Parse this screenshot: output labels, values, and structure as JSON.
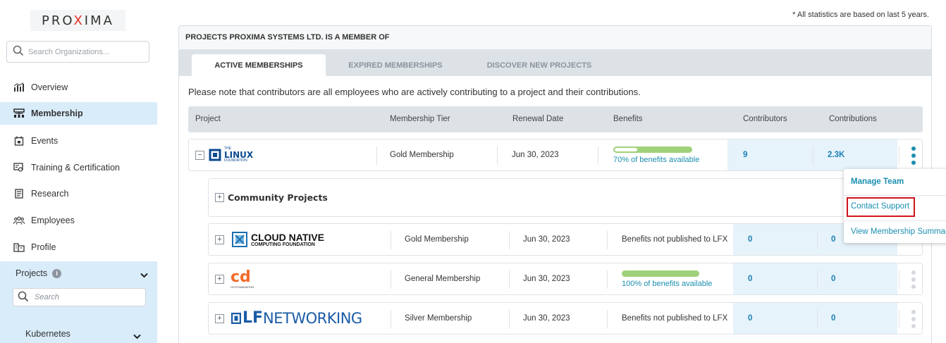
{
  "logo": {
    "pre": "PRO",
    "x": "X",
    "post": "IMA"
  },
  "sidebar": {
    "search_placeholder": "Search Organizations...",
    "items": [
      {
        "label": "Overview",
        "icon": "chart-icon"
      },
      {
        "label": "Membership",
        "icon": "membership-icon"
      },
      {
        "label": "Events",
        "icon": "calendar-icon"
      },
      {
        "label": "Training & Certification",
        "icon": "certification-icon"
      },
      {
        "label": "Research",
        "icon": "research-icon"
      },
      {
        "label": "Employees",
        "icon": "employees-icon"
      },
      {
        "label": "Profile",
        "icon": "profile-icon"
      }
    ],
    "projects": {
      "label": "Projects",
      "info": "i",
      "search_placeholder": "Search",
      "items": [
        {
          "label": "Kubernetes"
        }
      ]
    }
  },
  "stat_note": "* All statistics are based on last 5 years.",
  "card": {
    "title": "PROJECTS PROXIMA SYSTEMS LTD. IS A MEMBER OF",
    "tabs": [
      {
        "label": "ACTIVE MEMBERSHIPS"
      },
      {
        "label": "EXPIRED MEMBERSHIPS"
      },
      {
        "label": "DISCOVER NEW PROJECTS"
      }
    ],
    "note": "Please note that contributors are all employees who are actively contributing to a project and their contributions.",
    "columns": {
      "project": "Project",
      "tier": "Membership Tier",
      "renewal": "Renewal Date",
      "benefits": "Benefits",
      "contributors": "Contributors",
      "contributions": "Contributions"
    },
    "rows": {
      "linux": {
        "logo_small": "THE",
        "logo_main": "LINUX",
        "logo_sub": "FOUNDATION",
        "expander": "−",
        "tier": "Gold Membership",
        "renewal": "Jun 30, 2023",
        "benefits_fraction": 0.7,
        "benefits_text": "70% of benefits available",
        "contributors": "9",
        "contributions": "2.3K"
      },
      "community": {
        "label": "Community Projects",
        "expander": "+"
      },
      "cncf": {
        "logo_main": "CLOUD NATIVE",
        "logo_sub": "COMPUTING FOUNDATION",
        "expander": "+",
        "tier": "Gold Membership",
        "renewal": "Jun 30, 2023",
        "benefits_text": "Benefits not published to LFX",
        "contributors": "0",
        "contributions": "0"
      },
      "cdf": {
        "logo_main": "cd",
        "logo_sub": "CD.FOUNDATION",
        "expander": "+",
        "tier": "General Membership",
        "renewal": "Jun 30, 2023",
        "benefits_fraction": 1.0,
        "benefits_text": "100% of benefits available",
        "contributors": "0",
        "contributions": "0"
      },
      "lfn": {
        "logo_main": "LF",
        "logo_rest": "NETWORKING",
        "expander": "+",
        "tier": "Silver Membership",
        "renewal": "Jun 30, 2023",
        "benefits_text": "Benefits not published to LFX",
        "contributors": "0",
        "contributions": "0"
      }
    }
  },
  "dropdown": {
    "manage_team": "Manage Team",
    "contact_support": "Contact Support",
    "view_summary": "View Membership Summary"
  },
  "colors": {
    "accent": "#1b8fb0",
    "active_nav": "#d9ecfa",
    "progress": "#9fd17a",
    "highlight_border": "#d0141b",
    "cell_highlight": "#e6f3fa"
  }
}
